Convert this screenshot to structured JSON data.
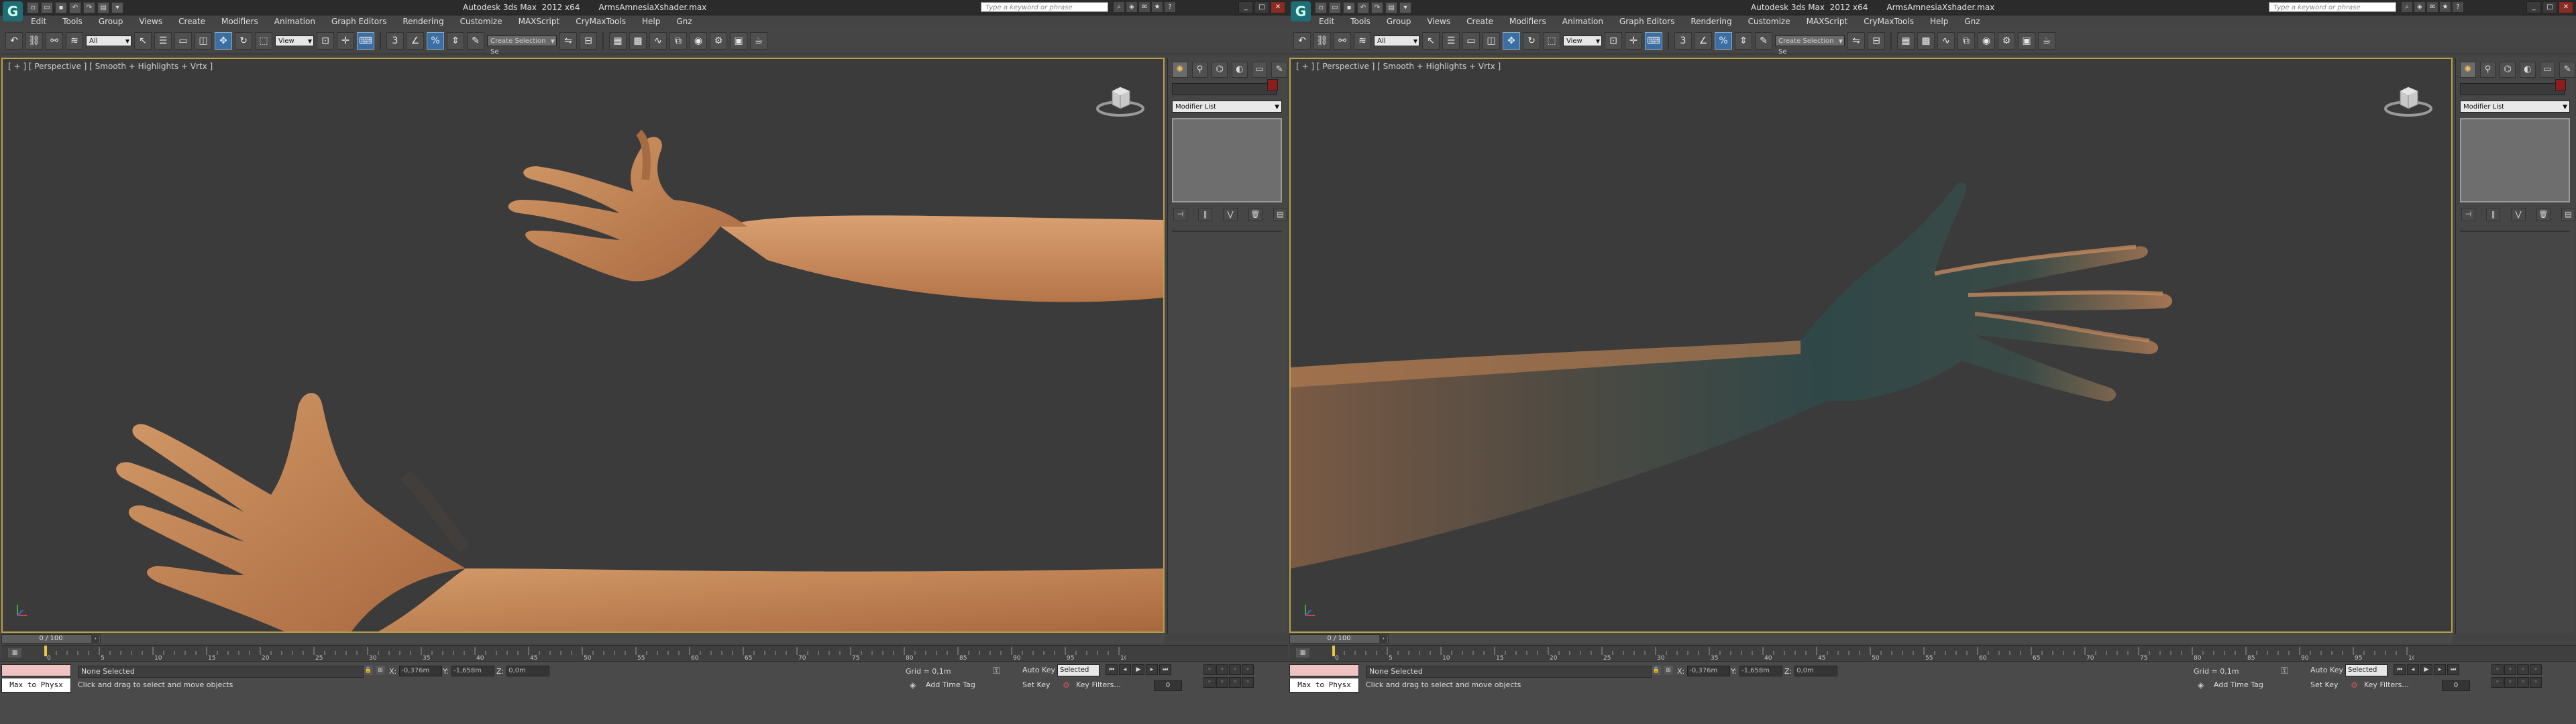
{
  "windows": [
    {
      "title": {
        "app": "Autodesk 3ds Max  2012 x64",
        "file": "ArmsAmnesiaXshader.max"
      },
      "search_placeholder": "Type a keyword or phrase",
      "menu": [
        "Edit",
        "Tools",
        "Group",
        "Views",
        "Create",
        "Modifiers",
        "Animation",
        "Graph Editors",
        "Rendering",
        "Customize",
        "MAXScript",
        "CryMaxTools",
        "Help",
        "Gnz"
      ],
      "toolbar": {
        "selection_filter": "All",
        "ref_coord": "View",
        "named_selection": "Create Selection Se"
      },
      "viewport": {
        "label": "[ + ] [ Perspective ] [ Smooth + Highlights + Vrtx ]",
        "scene": "Two outstretched left/right arms with open hands, rendered in warm skin tone"
      },
      "command_panel": {
        "modifier_list": "Modifier List"
      },
      "time_slider": {
        "label": "0 / 100"
      },
      "track": {
        "ticks": [
          "0",
          "5",
          "10",
          "15",
          "20",
          "25",
          "30",
          "35",
          "40",
          "45",
          "50",
          "55",
          "60",
          "65",
          "70",
          "75",
          "80",
          "85",
          "90",
          "95",
          "100"
        ]
      },
      "status": {
        "maxscript": "Max to Physx",
        "selection": "None Selected",
        "prompt": "Click and drag to select and move objects",
        "x_label": "X:",
        "x": "-0,376m",
        "y_label": "Y:",
        "y": "-1,658m",
        "z_label": "Z:",
        "z": "0,0m",
        "grid": "Grid = 0,1m",
        "auto_key": "Auto Key",
        "key_mode": "Selected",
        "set_key": "Set Key",
        "key_filters": "Key Filters...",
        "add_time_tag": "Add Time Tag",
        "frame": "0"
      }
    },
    {
      "title": {
        "app": "Autodesk 3ds Max  2012 x64",
        "file": "ArmsAmnesiaXshader.max"
      },
      "search_placeholder": "Type a keyword or phrase",
      "menu": [
        "Edit",
        "Tools",
        "Group",
        "Views",
        "Create",
        "Modifiers",
        "Animation",
        "Graph Editors",
        "Rendering",
        "Customize",
        "MAXScript",
        "CryMaxTools",
        "Help",
        "Gnz"
      ],
      "toolbar": {
        "selection_filter": "All",
        "ref_coord": "View",
        "named_selection": "Create Selection Se"
      },
      "viewport": {
        "label": "[ + ] [ Perspective ] [ Smooth + Highlights + Vrtx ]",
        "scene": "Single outstretched arm with open hand, back side in shadow"
      },
      "command_panel": {
        "modifier_list": "Modifier List"
      },
      "time_slider": {
        "label": "0 / 100"
      },
      "track": {
        "ticks": [
          "0",
          "5",
          "10",
          "15",
          "20",
          "25",
          "30",
          "35",
          "40",
          "45",
          "50",
          "55",
          "60",
          "65",
          "70",
          "75",
          "80",
          "85",
          "90",
          "95",
          "100"
        ]
      },
      "status": {
        "maxscript": "Max to Physx",
        "selection": "None Selected",
        "prompt": "Click and drag to select and move objects",
        "x_label": "X:",
        "x": "-0,376m",
        "y_label": "Y:",
        "y": "-1,658m",
        "z_label": "Z:",
        "z": "0,0m",
        "grid": "Grid = 0,1m",
        "auto_key": "Auto Key",
        "key_mode": "Selected",
        "set_key": "Set Key",
        "key_filters": "Key Filters...",
        "add_time_tag": "Add Time Tag",
        "frame": "0"
      }
    }
  ],
  "colors": {
    "viewport_border": "#b8a04a",
    "skin": "#c98a57",
    "skin_shadow": "#2f4748",
    "background": "#3b3b3b"
  }
}
